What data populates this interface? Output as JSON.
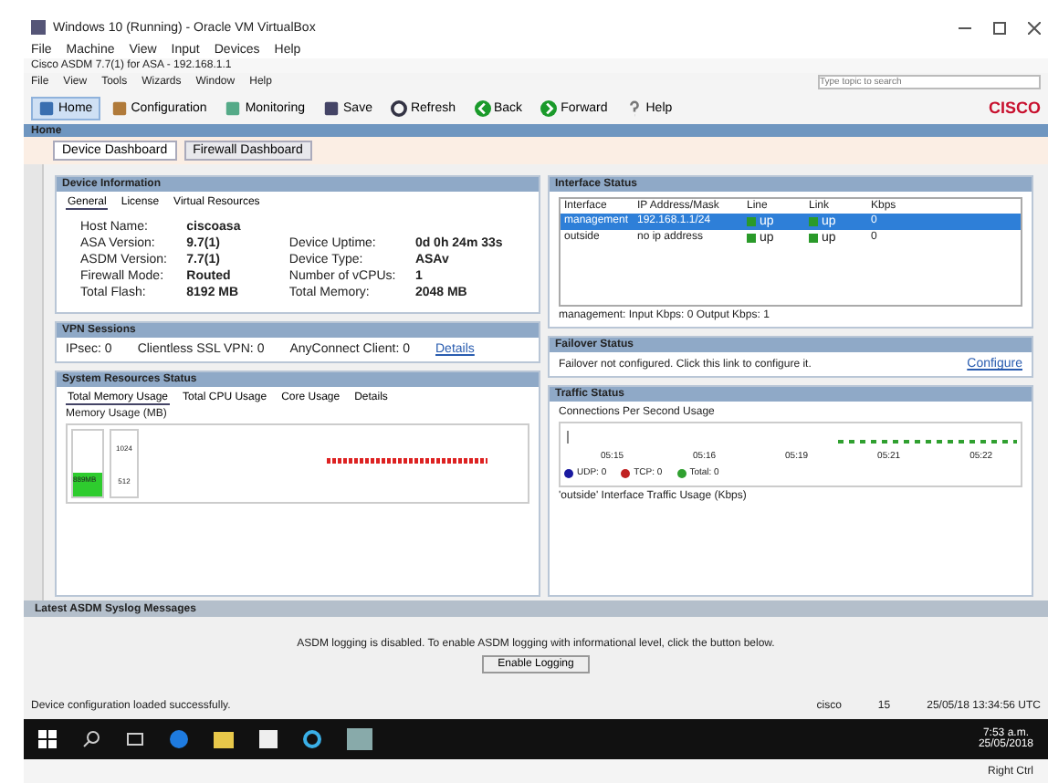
{
  "vbox": {
    "title": "Windows 10 (Running) - Oracle VM VirtualBox",
    "menu": [
      "File",
      "Machine",
      "View",
      "Input",
      "Devices",
      "Help"
    ]
  },
  "asdm": {
    "title": "Cisco ASDM 7.7(1) for ASA - 192.168.1.1",
    "menu": [
      "File",
      "View",
      "Tools",
      "Wizards",
      "Window",
      "Help"
    ],
    "search_placeholder": "Type topic to search",
    "logo": "CISCO"
  },
  "toolbar": [
    {
      "label": "Home",
      "selected": true
    },
    {
      "label": "Configuration",
      "selected": false
    },
    {
      "label": "Monitoring",
      "selected": false
    },
    {
      "label": "Save",
      "selected": false
    },
    {
      "label": "Refresh",
      "selected": false
    },
    {
      "label": "Back",
      "selected": false
    },
    {
      "label": "Forward",
      "selected": false
    },
    {
      "label": "Help",
      "selected": false
    }
  ],
  "home_title": "Home",
  "dashboard_tabs": [
    {
      "label": "Device Dashboard",
      "selected": true
    },
    {
      "label": "Firewall Dashboard",
      "selected": false
    }
  ],
  "device_info": {
    "title": "Device Information",
    "tabs": [
      {
        "label": "General",
        "selected": true
      },
      {
        "label": "License",
        "selected": false
      },
      {
        "label": "Virtual Resources",
        "selected": false
      }
    ],
    "left": [
      {
        "label": "Host Name:",
        "value": "ciscoasa"
      },
      {
        "label": "ASA Version:",
        "value": "9.7(1)"
      },
      {
        "label": "ASDM Version:",
        "value": "7.7(1)"
      },
      {
        "label": "Firewall Mode:",
        "value": "Routed"
      },
      {
        "label": "Total Flash:",
        "value": "8192 MB"
      }
    ],
    "right": [
      {
        "label": "Device Uptime:",
        "value": "0d 0h 24m 33s"
      },
      {
        "label": "Device Type:",
        "value": "ASAv"
      },
      {
        "label": "Number of vCPUs:",
        "value": "1"
      },
      {
        "label": "Total Memory:",
        "value": "2048 MB"
      }
    ]
  },
  "vpn": {
    "title": "VPN Sessions",
    "items": [
      {
        "label": "IPsec:",
        "value": "0"
      },
      {
        "label": "Clientless SSL VPN:",
        "value": "0"
      },
      {
        "label": "AnyConnect Client:",
        "value": "0"
      }
    ],
    "link": "Details"
  },
  "system_resources": {
    "title": "System Resources Status",
    "tabs": [
      {
        "label": "Total Memory Usage",
        "selected": true
      },
      {
        "label": "Total CPU Usage",
        "selected": false
      },
      {
        "label": "Core Usage",
        "selected": false
      },
      {
        "label": "Details",
        "selected": false
      }
    ],
    "chart_title": "Memory Usage (MB)",
    "axis": [
      "1024",
      "512"
    ],
    "bar_label": "889MB",
    "level": 0.35
  },
  "interface_status": {
    "title": "Interface Status",
    "columns": [
      "Interface",
      "IP Address/Mask",
      "Line",
      "Link",
      "Kbps"
    ],
    "rows": [
      {
        "interface": "management",
        "ip": "192.168.1.1/24",
        "line": "up",
        "link": "up",
        "kbps": "0",
        "selected": true
      },
      {
        "interface": "outside",
        "ip": "no ip address",
        "line": "up",
        "link": "up",
        "kbps": "0",
        "selected": false
      }
    ],
    "footer": "management: Input Kbps: 0   Output Kbps: 1"
  },
  "failover": {
    "title": "Failover Status",
    "message": "Failover not configured. Click this link to configure it.",
    "link": "Configure"
  },
  "traffic": {
    "title": "Traffic Status",
    "chart_title": "Connections Per Second Usage",
    "times": [
      "05:15",
      "05:16",
      "05:19",
      "05:21",
      "05:22"
    ],
    "legend": [
      {
        "label": "UDP: 0",
        "color": "#1a1aa0"
      },
      {
        "label": "TCP: 0",
        "color": "#c02020"
      },
      {
        "label": "Total: 0",
        "color": "#30a030"
      }
    ],
    "subtitle": "'outside' Interface Traffic Usage (Kbps)"
  },
  "syslog": {
    "title": "Latest ASDM Syslog Messages",
    "message": "ASDM logging is disabled. To enable ASDM logging with informational level, click the button below.",
    "button": "Enable Logging"
  },
  "status_bar": {
    "message": "Device configuration loaded successfully.",
    "user": "cisco",
    "privilege": "15",
    "datetime": "25/05/18 13:34:56 UTC"
  },
  "taskbar": {
    "time": "7:53 a.m.",
    "date": "25/05/2018"
  },
  "vbox_status": {
    "host_key": "Right Ctrl"
  }
}
